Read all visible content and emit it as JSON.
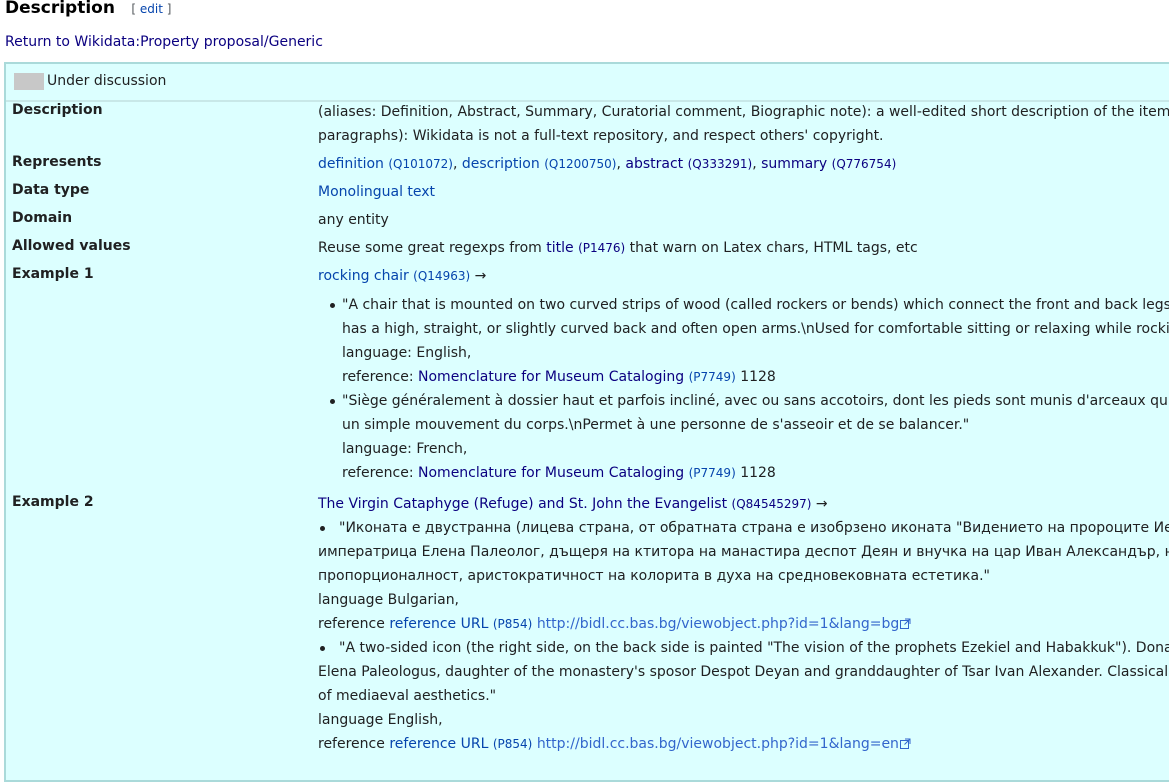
{
  "heading": {
    "title": "Description",
    "edit_open": "[",
    "edit_label": "edit",
    "edit_close": "]"
  },
  "return_link": "Return to Wikidata:Property proposal/Generic",
  "status": "Under discussion",
  "rows": {
    "description": {
      "label": "Description",
      "line1": "(aliases: Definition, Abstract, Summary, Curatorial comment, Biographic note): a well-edited short description of the item, with",
      "line2": "paragraphs): Wikidata is not a full-text repository, and respect others' copyright."
    },
    "represents": {
      "label": "Represents",
      "items": [
        {
          "text": "definition",
          "qid": "(Q101072)",
          "sep": ", "
        },
        {
          "text": "description",
          "qid": "(Q1200750)",
          "sep": ", "
        },
        {
          "text": "abstract",
          "qid": "(Q333291)",
          "sep": ", "
        },
        {
          "text": "summary",
          "qid": "(Q776754)",
          "sep": ""
        }
      ]
    },
    "data_type": {
      "label": "Data type",
      "value": "Monolingual text"
    },
    "domain": {
      "label": "Domain",
      "value": "any entity"
    },
    "allowed_values": {
      "label": "Allowed values",
      "pre": "Reuse some great regexps from ",
      "link": "title",
      "qid": "(P1476)",
      "post": " that warn on Latex chars, HTML tags, etc"
    },
    "example1": {
      "label": "Example 1",
      "subject": "rocking chair",
      "subject_qid": "(Q14963)",
      "arrow": "→",
      "entries": [
        {
          "line1": "\"A chair that is mounted on two curved strips of wood (called rockers or bends) which connect the front and back legs, allo",
          "line2": "has a high, straight, or slightly curved back and often open arms.\\nUsed for comfortable sitting or relaxing while rocking.\"",
          "language": "language: English,",
          "ref_pre": "reference: ",
          "ref_link": "Nomenclature for Museum Cataloging",
          "ref_qid": "(P7749)",
          "ref_post": " 1128"
        },
        {
          "line1": "\"Siège généralement à dossier haut et parfois incliné, avec ou sans accotoirs, dont les pieds sont munis d'arceaux qui per",
          "line2": "un simple mouvement du corps.\\nPermet à une personne de s'asseoir et de se balancer.\"",
          "language": "language: French,",
          "ref_pre": "reference: ",
          "ref_link": "Nomenclature for Museum Cataloging",
          "ref_qid": "(P7749)",
          "ref_post": " 1128"
        }
      ]
    },
    "example2": {
      "label": "Example 2",
      "subject": "The Virgin Cataphyge (Refuge) and St. John the Evangelist",
      "subject_qid": "(Q84545297)",
      "arrow": "→",
      "entries": [
        {
          "line1": "\"Иконата е двустранна (лицева страна, от обратната страна е изобрзено иконата \"Видението на пророците Иезеки",
          "line2": "императрица Елена Палеолог, дъщеря на ктитора на манастира деспот Деян и внучка на цар Иван Александър, на По",
          "line3": "пропорционалност, аристократичност на колорита в духа на средновековната естетика.\"",
          "language": "language Bulgarian,",
          "ref_pre": "reference ",
          "ref_link": "reference URL",
          "ref_qid": "(P854)",
          "ref_url": "http://bidl.cc.bas.bg/viewobject.php?id=1&lang=bg"
        },
        {
          "line1": "\"A two-sided icon (the right side, on the back side is painted \"The vision of the prophets Ezekiel and Habakkuk\"). Donated",
          "line2": "Elena Paleologus, daughter of the monastery's sposor Despot Deyan and granddaughter of Tsar Ivan Alexander. Classical be",
          "line3": "of mediaeval aesthetics.\"",
          "language": "language English,",
          "ref_pre": "reference ",
          "ref_link": "reference URL",
          "ref_qid": "(P854)",
          "ref_url": "http://bidl.cc.bas.bg/viewobject.php?id=1&lang=en"
        }
      ]
    }
  },
  "colors": {
    "box_bg": "#dcffff",
    "link": "#0645ad",
    "visited_link": "#0b0080",
    "status_swatch": "#c8c8c8"
  }
}
